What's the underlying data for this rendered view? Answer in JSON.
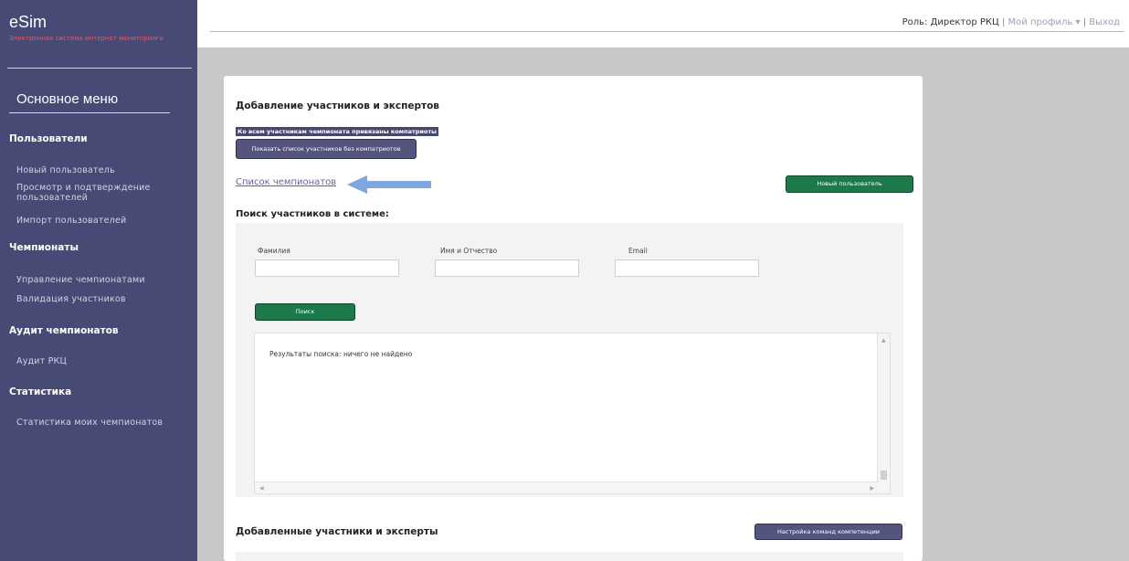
{
  "app": {
    "logo": "eSim",
    "subtitle": "Электронная система интернет мониторинга"
  },
  "sidebar": {
    "main_menu": "Основное меню",
    "sections": [
      {
        "title": "Пользователи",
        "items": [
          "Новый пользователь",
          "Просмотр и подтверждение пользователей",
          "Импорт пользователей"
        ]
      },
      {
        "title": "Чемпионаты",
        "items": [
          "Управление чемпионатами",
          "Валидация участников"
        ]
      },
      {
        "title": "Аудит чемпионатов",
        "items": [
          "Аудит РКЦ"
        ]
      },
      {
        "title": "Статистика",
        "items": [
          "Статистика моих чемпионатов"
        ]
      }
    ]
  },
  "header": {
    "role": "Роль: Директор РКЦ",
    "sep1": "|",
    "profile": "Мой профиль",
    "profile_caret": "▾",
    "sep2": "|",
    "logout": "Выход"
  },
  "content": {
    "title": "Добавление участников и экспертов",
    "notice": "Ко всем участникам чемпионата привязаны компатриоты",
    "show_without_compatriots": "Показать список участников без компатриотов",
    "champ_list_link": "Список чемпионатов",
    "new_user_button": "Новый пользователь",
    "search_title": "Поиск участников в системе:",
    "search": {
      "lastname_label": "Фамилия",
      "lastname_value": "",
      "name_label": "Имя и Отчество",
      "name_value": "",
      "email_label": "Email",
      "email_value": "",
      "search_button": "Поиск",
      "results_text": "Результаты поиска: ничего не найдено"
    },
    "added_title": "Добавленные участники и эксперты",
    "team_settings_button": "Настройка команд компетенции"
  },
  "colors": {
    "sidebar_bg": "#474a74",
    "accent_red": "#e8566b",
    "green_button": "#1c7a4a",
    "violet_button": "#53557f",
    "link": "#6b5aa8",
    "arrow": "#7ea6e0"
  }
}
